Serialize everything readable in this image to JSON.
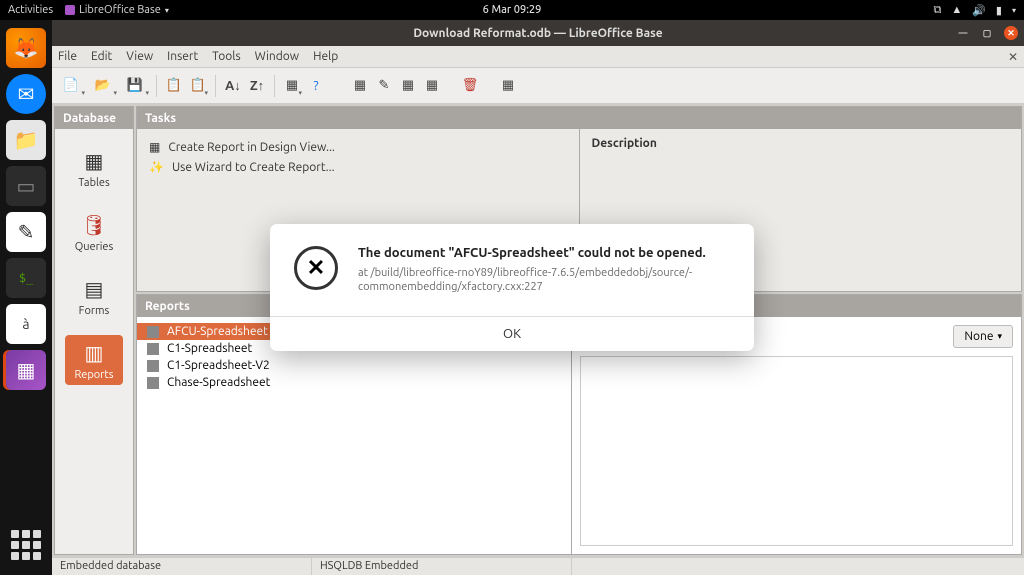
{
  "gnome": {
    "activities": "Activities",
    "app_name": "LibreOffice Base",
    "datetime": "6 Mar  09:29"
  },
  "window": {
    "title": "Download Reformat.odb — LibreOffice Base"
  },
  "menu": {
    "file": "File",
    "edit": "Edit",
    "view": "View",
    "insert": "Insert",
    "tools": "Tools",
    "window": "Window",
    "help": "Help"
  },
  "panels": {
    "database": "Database",
    "tasks": "Tasks",
    "reports": "Reports",
    "description": "Description"
  },
  "db_items": {
    "tables": "Tables",
    "queries": "Queries",
    "forms": "Forms",
    "reports": "Reports"
  },
  "tasks": {
    "design": "Create Report in Design View...",
    "wizard": "Use Wizard to Create Report..."
  },
  "reports": [
    "AFCU-Spreadsheet",
    "C1-Spreadsheet",
    "C1-Spreadsheet-V2",
    "Chase-Spreadsheet"
  ],
  "preview": {
    "none": "None"
  },
  "status": {
    "label": "Embedded database",
    "engine": "HSQLDB Embedded"
  },
  "dialog": {
    "title": "The document \"AFCU-Spreadsheet\" could not be opened.",
    "detail": "at /build/libreoffice-rnoY89/libreoffice-7.6.5/embeddedobj/source/-commonembedding/xfactory.cxx:227",
    "ok": "OK"
  }
}
